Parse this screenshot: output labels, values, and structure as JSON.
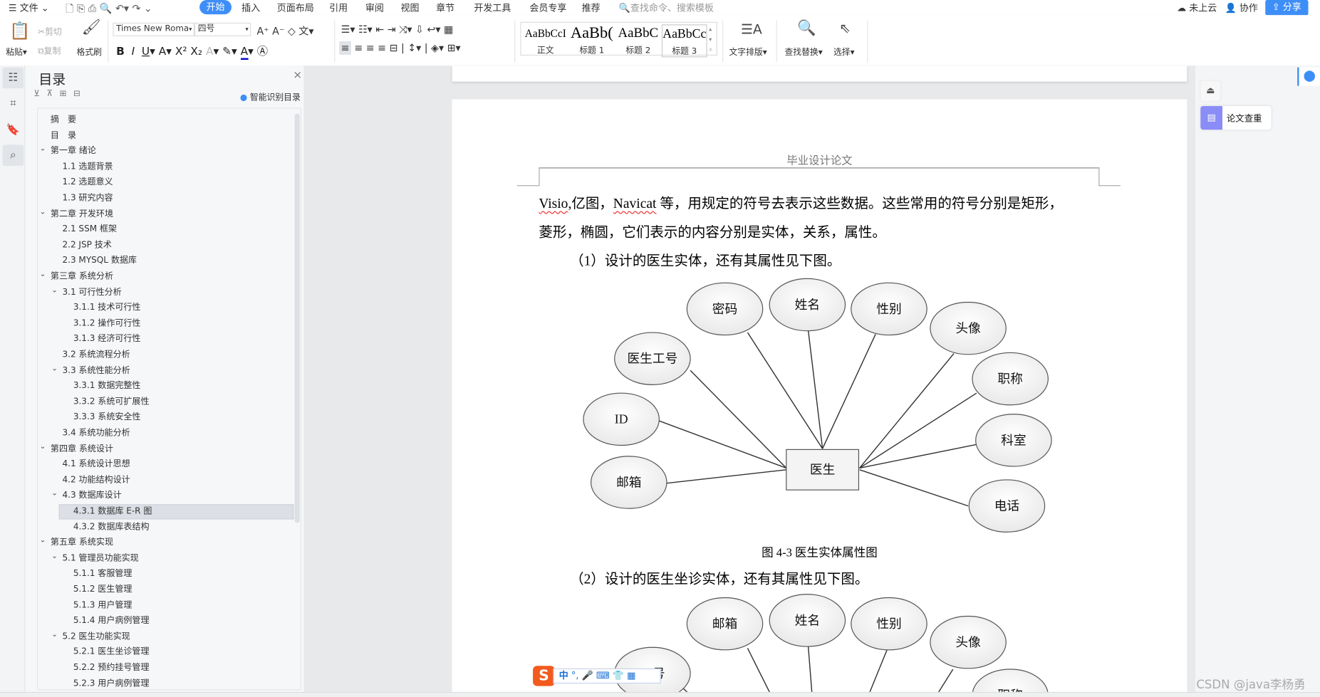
{
  "menu": {
    "file": "文件",
    "tabs": [
      "开始",
      "插入",
      "页面布局",
      "引用",
      "审阅",
      "视图",
      "章节",
      "开发工具",
      "会员专享",
      "推荐"
    ],
    "active_tab": "开始",
    "search_placeholder": "查找命令、搜索模板",
    "cloud": "未上云",
    "collab": "协作",
    "share": "分享"
  },
  "ribbon": {
    "paste": "粘贴",
    "cut": "剪切",
    "copy": "复制",
    "format_painter": "格式刷",
    "font_name": "Times New Roma",
    "font_size": "四号",
    "styles": [
      {
        "sample": "AaBbCcI",
        "label": "正文"
      },
      {
        "sample": "AaBb(",
        "label": "标题 1"
      },
      {
        "sample": "AaBbC",
        "label": "标题 2"
      },
      {
        "sample": "AaBbCc",
        "label": "标题 3"
      }
    ],
    "text_layout": "文字排版",
    "find_replace": "查找替换",
    "select": "选择"
  },
  "toc": {
    "title": "目录",
    "smart": "智能识别目录",
    "selected": "4.3.1 数据库 E-R 图",
    "items": [
      {
        "t": "摘　要",
        "l": 1,
        "c": false
      },
      {
        "t": "目　录",
        "l": 1,
        "c": false
      },
      {
        "t": "第一章 绪论",
        "l": 1,
        "c": true
      },
      {
        "t": "1.1 选题背景",
        "l": 2,
        "c": false
      },
      {
        "t": "1.2 选题意义",
        "l": 2,
        "c": false
      },
      {
        "t": "1.3 研究内容",
        "l": 2,
        "c": false
      },
      {
        "t": "第二章 开发环境",
        "l": 1,
        "c": true
      },
      {
        "t": "2.1 SSM 框架",
        "l": 2,
        "c": false
      },
      {
        "t": "2.2 JSP 技术",
        "l": 2,
        "c": false
      },
      {
        "t": "2.3 MYSQL 数据库",
        "l": 2,
        "c": false
      },
      {
        "t": "第三章 系统分析",
        "l": 1,
        "c": true
      },
      {
        "t": "3.1 可行性分析",
        "l": 2,
        "c": true
      },
      {
        "t": "3.1.1 技术可行性",
        "l": 3,
        "c": false
      },
      {
        "t": "3.1.2 操作可行性",
        "l": 3,
        "c": false
      },
      {
        "t": "3.1.3 经济可行性",
        "l": 3,
        "c": false
      },
      {
        "t": "3.2 系统流程分析",
        "l": 2,
        "c": false
      },
      {
        "t": "3.3 系统性能分析",
        "l": 2,
        "c": true
      },
      {
        "t": "3.3.1 数据完整性",
        "l": 3,
        "c": false
      },
      {
        "t": "3.3.2 系统可扩展性",
        "l": 3,
        "c": false
      },
      {
        "t": "3.3.3 系统安全性",
        "l": 3,
        "c": false
      },
      {
        "t": "3.4 系统功能分析",
        "l": 2,
        "c": false
      },
      {
        "t": "第四章 系统设计",
        "l": 1,
        "c": true
      },
      {
        "t": "4.1 系统设计思想",
        "l": 2,
        "c": false
      },
      {
        "t": "4.2 功能结构设计",
        "l": 2,
        "c": false
      },
      {
        "t": "4.3 数据库设计",
        "l": 2,
        "c": true
      },
      {
        "t": "4.3.1 数据库 E-R 图",
        "l": 3,
        "c": false
      },
      {
        "t": "4.3.2 数据库表结构",
        "l": 3,
        "c": false
      },
      {
        "t": "第五章 系统实现",
        "l": 1,
        "c": true
      },
      {
        "t": "5.1 管理员功能实现",
        "l": 2,
        "c": true
      },
      {
        "t": "5.1.1 客服管理",
        "l": 3,
        "c": false
      },
      {
        "t": "5.1.2 医生管理",
        "l": 3,
        "c": false
      },
      {
        "t": "5.1.3 用户管理",
        "l": 3,
        "c": false
      },
      {
        "t": "5.1.4 用户病例管理",
        "l": 3,
        "c": false
      },
      {
        "t": "5.2 医生功能实现",
        "l": 2,
        "c": true
      },
      {
        "t": "5.2.1 医生坐诊管理",
        "l": 3,
        "c": false
      },
      {
        "t": "5.2.2 预约挂号管理",
        "l": 3,
        "c": false
      },
      {
        "t": "5.2.3 用户病例管理",
        "l": 3,
        "c": false
      }
    ]
  },
  "doc": {
    "header": "毕业设计论文",
    "p1_a": "Visio",
    "p1_b": ",亿图，",
    "p1_c": "Navicat",
    "p1_d": " 等，用规定的符号去表示这些数据。这些常用的符号分别是矩形，",
    "p2": "菱形，椭圆，它们表示的内容分别是实体，关系，属性。",
    "p3": "（1）设计的医生实体，还有其属性见下图。",
    "caption1": "图 4-3  医生实体属性图",
    "p4": "（2）设计的医生坐诊实体，还有其属性见下图。"
  },
  "diagram1": {
    "entity": "医生",
    "attributes": [
      "密码",
      "姓名",
      "性别",
      "头像",
      "医生工号",
      "ID",
      "邮箱",
      "职称",
      "科室",
      "电话"
    ]
  },
  "diagram2": {
    "attributes": [
      "邮箱",
      "姓名",
      "性别",
      "头像",
      "工号",
      "职称"
    ]
  },
  "right_panel": {
    "check": "论文查重"
  },
  "ime": {
    "mode": "中",
    "punct": "°,"
  },
  "watermark": "CSDN @java李杨勇"
}
